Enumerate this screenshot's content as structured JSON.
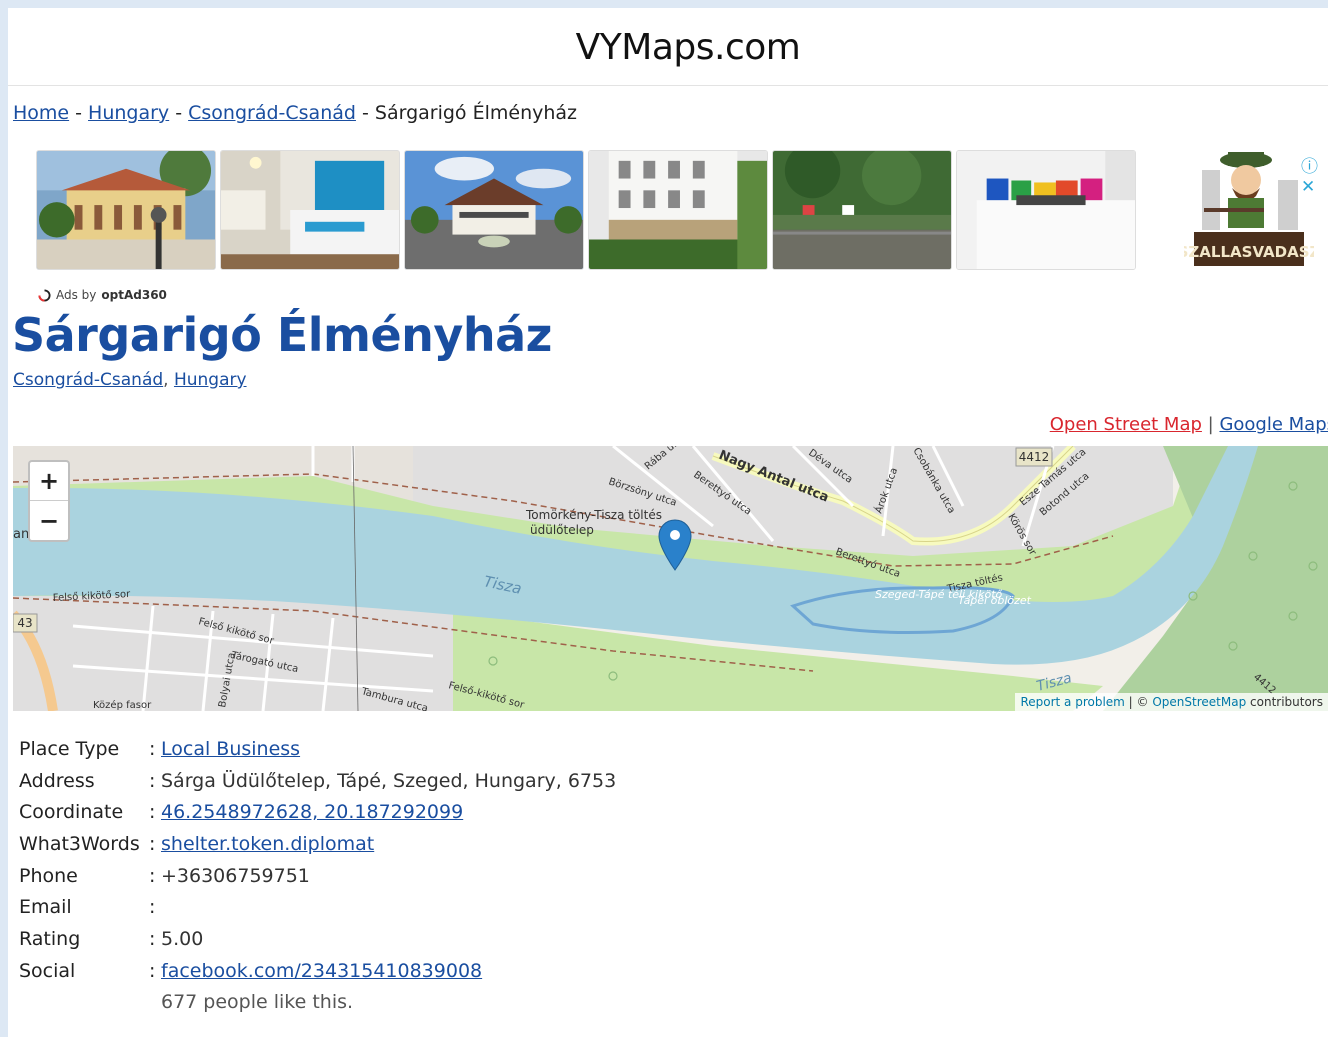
{
  "site": {
    "title": "VYMaps.com"
  },
  "breadcrumb": {
    "items": [
      "Home",
      "Hungary",
      "Csongrád-Csanád"
    ],
    "separator": " - ",
    "current": "Sárgarigó Élményház"
  },
  "ads": {
    "attribution_prefix": "Ads by",
    "attribution_brand": "optAd360",
    "brand_logo_text": "SZALLASVADASZ",
    "info_icon": "info-icon",
    "close_icon": "close-icon"
  },
  "place": {
    "name": "Sárgarigó Élményház",
    "region": "Csongrád-Csanád",
    "country": "Hungary",
    "region_separator": ", "
  },
  "map_links": {
    "osm": "Open Street Map",
    "separator": " | ",
    "google": "Google Maps"
  },
  "map": {
    "zoom_in": "+",
    "zoom_out": "−",
    "labels": {
      "tiszatoltes": "Tomörkény-Tisza töltés",
      "udulotelep": "üdülőtelep",
      "tisza": "Tisza",
      "tisza2": "Tisza",
      "nagy_antal": "Nagy Antal utca",
      "berettyo": "Berettyó utca",
      "deva": "Déva utca",
      "borzsony": "Börzsöny utca",
      "raba": "Rába u.",
      "arok": "Árok utca",
      "csobanka": "Csobánka utca",
      "road_4412": "4412",
      "road_4412b": "4412",
      "road_43": "43",
      "esze": "Esze Tamás utca",
      "botond": "Botond utca",
      "koros": "Körös sor",
      "tisza_toltes": "Tisza töltés",
      "berettyo2": "Berettyó utca",
      "kikoto": "Szeged-Tápé téli kikötő",
      "obol": "Tápéi öblözet",
      "felso_kikoto1": "Felső kikötő sor",
      "felso_kikoto2": "Felső kikötő sor",
      "felso_kikoto3": "Felső-kikötő sor",
      "tarogato": "Tárogató utca",
      "tambura": "Tambura utca",
      "kozep_fasor": "Közép fasor",
      "bolyai": "Bolyai utca",
      "edge_an": "an"
    },
    "attribution": {
      "report": "Report a problem",
      "sep": " | © ",
      "osm": "OpenStreetMap",
      "suffix": " contributors"
    },
    "colors": {
      "water": "#aad3df",
      "park": "#c8e6a8",
      "forest": "#add19e",
      "residential": "#e0dfdf",
      "marker": "#2a81cb"
    }
  },
  "details": {
    "rows": [
      {
        "label": "Place Type",
        "value": "Local Business",
        "link": true
      },
      {
        "label": "Address",
        "value": "Sárga Üdülőtelep, Tápé, Szeged, Hungary, 6753",
        "link": false
      },
      {
        "label": "Coordinate",
        "value": "46.2548972628, 20.187292099",
        "link": true
      },
      {
        "label": "What3Words",
        "value": "shelter.token.diplomat",
        "link": true
      },
      {
        "label": "Phone",
        "value": "+36306759751",
        "link": false
      },
      {
        "label": "Email",
        "value": "",
        "link": false
      },
      {
        "label": "Rating",
        "value": "5.00",
        "link": false
      },
      {
        "label": "Social",
        "value": "facebook.com/234315410839008",
        "link": true
      }
    ],
    "likes": "677 people like this."
  }
}
